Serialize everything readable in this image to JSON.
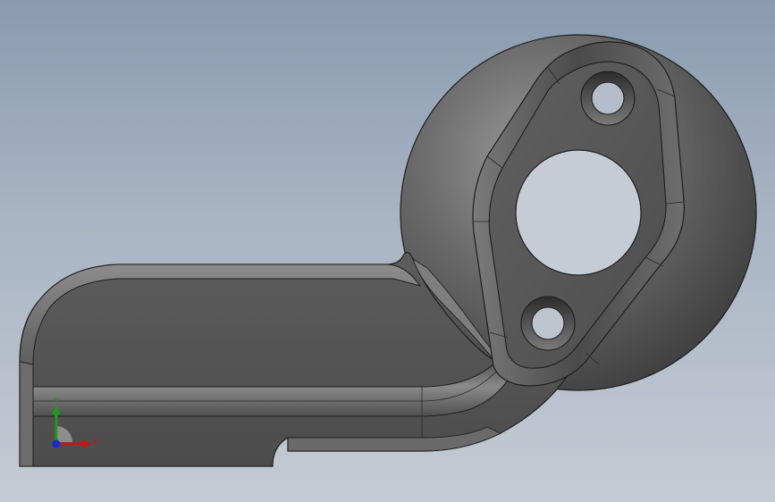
{
  "scene": {
    "colors": {
      "background_top": "#8a9bb0",
      "background_bottom": "#c4cbd4",
      "part_face": "#5a5a5a",
      "part_dark": "#3e3e3e",
      "part_light": "#8a8a8a",
      "edge": "#1e1e1e"
    }
  },
  "triad": {
    "x_label": "X",
    "y_label": "Y",
    "x_color": "#c81414",
    "y_color": "#1e9a1e",
    "z_color": "#1a2cc8"
  }
}
